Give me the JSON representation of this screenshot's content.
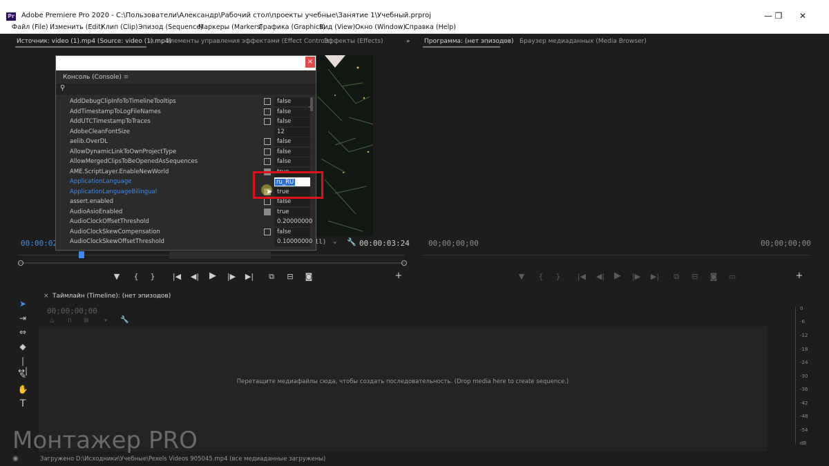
{
  "window": {
    "title": "Adobe Premiere Pro 2020 - C:\\Пользователи\\Александр\\Рабочий стол\\проекты учебные\\Занятие 1\\Учебный.prproj",
    "app_icon": "Pr"
  },
  "menu": [
    "Файл (File)",
    "Изменить (Edit)",
    "Клип (Clip)",
    "Эпизод (Sequence)",
    "Маркеры (Markers)",
    "Графика (Graphics)",
    "Вид (View)",
    "Окно (Window)",
    "Справка (Help)"
  ],
  "source_panel": {
    "tabs": [
      "Источник: video (1).mp4 (Source: video (1).mp4)",
      "Элементы управления эффектами (Effect Controls)",
      "Эффекты (Effects)"
    ],
    "timecode_left": "00:00:02:1",
    "timecode_right": "00:00:03:24",
    "fit_fragment": "ll)"
  },
  "program_panel": {
    "tabs": [
      "Программа: (нет эпизодов)",
      "Браузер медиаданных (Media Browser)"
    ],
    "timecode_left": "00;00;00;00",
    "timecode_right": "00;00;00;00"
  },
  "timeline": {
    "title": "Таймлайн (Timeline): (нет эпизодов)",
    "timecode": "00;00;00;00",
    "drop_message": "Перетащите медиафайлы сюда, чтобы создать последовательность. (Drop media here to create sequence.)"
  },
  "meter_labels": [
    "0",
    "-6",
    "-12",
    "-18",
    "-24",
    "-30",
    "-36",
    "-42",
    "-48",
    "-54",
    "dB"
  ],
  "console": {
    "title": "Консоль (Console)",
    "rows": [
      {
        "name": "AddDebugClipInfoToTimelineTooltips",
        "checkbox": "off",
        "value": "false"
      },
      {
        "name": "AddTimestampToLogFileNames",
        "checkbox": "off",
        "value": "false"
      },
      {
        "name": "AddUTCTimestampToTraces",
        "checkbox": "off",
        "value": "false"
      },
      {
        "name": "AdobeCleanFontSize",
        "checkbox": "none",
        "value": "12"
      },
      {
        "name": "aelib.OverDL",
        "checkbox": "off",
        "value": "false"
      },
      {
        "name": "AllowDynamicLinkToOwnProjectType",
        "checkbox": "off",
        "value": "false"
      },
      {
        "name": "AllowMergedClipsToBeOpenedAsSequences",
        "checkbox": "off",
        "value": "false"
      },
      {
        "name": "AME.ScriptLayer.EnableNewWorld",
        "checkbox": "on",
        "value": "true"
      },
      {
        "name": "ApplicationLanguage",
        "checkbox": "none",
        "value": "ru_RU",
        "highlight": true,
        "editing": true
      },
      {
        "name": "ApplicationLanguageBilingual",
        "checkbox": "on",
        "value": "true",
        "highlight": true
      },
      {
        "name": "assert.enabled",
        "checkbox": "off",
        "value": "false"
      },
      {
        "name": "AudioAsioEnabled",
        "checkbox": "on",
        "value": "true"
      },
      {
        "name": "AudioClockOffsetThreshold",
        "checkbox": "none",
        "value": "0.20000000"
      },
      {
        "name": "AudioClockSkewCompensation",
        "checkbox": "off",
        "value": "false"
      },
      {
        "name": "AudioClockSkewOffsetThreshold",
        "checkbox": "none",
        "value": "0.10000000"
      }
    ]
  },
  "status": {
    "text": "Загружено D:\\Исходники\\Учебные\\Pexels Videos 905045.mp4 (все медиаданные загружены)"
  },
  "watermark": "Монтажер PRO",
  "colors": {
    "accent_blue": "#3d8df0",
    "highlight_red": "#e0101b",
    "close_red": "#e04848"
  }
}
